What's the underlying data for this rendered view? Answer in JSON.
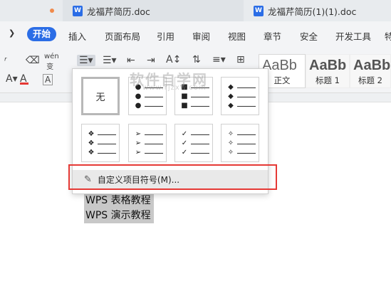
{
  "tabs": [
    {
      "label": "龙福芹简历.doc"
    },
    {
      "label": "龙福芹简历(1)(1).doc"
    }
  ],
  "menu": {
    "items": [
      "开始",
      "插入",
      "页面布局",
      "引用",
      "审阅",
      "视图",
      "章节",
      "安全",
      "开发工具",
      "特"
    ]
  },
  "toolbar": {
    "pinyin": "wén",
    "styles": [
      {
        "sample": "AaBb",
        "name": "正文"
      },
      {
        "sample": "AaBb",
        "name": "标题 1"
      },
      {
        "sample": "AaBb",
        "name": "标题 2"
      }
    ]
  },
  "dropdown": {
    "none_label": "无",
    "custom_label": "自定义项目符号(M)..."
  },
  "watermark": {
    "main": "软件自学网",
    "sub": "www.rjzxw.com"
  },
  "document": {
    "lines": [
      "WPS 表格教程",
      "WPS 演示教程"
    ]
  },
  "colors": {
    "accent": "#2b6de6",
    "highlight_border": "#e53935",
    "selection": "#c8c8c8"
  }
}
